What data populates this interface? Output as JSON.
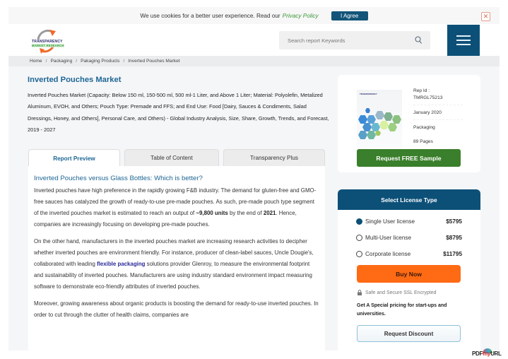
{
  "cookie_bar": {
    "message": "We use cookies for a better user experience. Read our",
    "privacy_link": "Privacy Policy",
    "agree_label": "I Agree",
    "close_icon": "close-icon"
  },
  "header": {
    "logo_line1": "TRANSPARENCY",
    "logo_line2": "MARKET RESEARCH",
    "search_placeholder": "Search report Keywords",
    "search_icon": "search-icon",
    "menu_icon": "hamburger-menu-icon"
  },
  "breadcrumb": [
    "Home",
    "Packaging",
    "Pakaging Products",
    "Inverted Pouches Market"
  ],
  "report": {
    "title": "Inverted Pouches Market",
    "subtitle": "Inverted Pouches Market (Capacity: Below 150 ml, 150-500 ml, 500 ml-1 Liter, and Above 1 Liter; Material: Polyolefin, Metalized Aluminum, EVOH, and Others; Pouch Type: Premade and FFS; and End Use: Food [Dairy, Sauces & Condiments, Salad Dressings, Honey, and Others], Personal Care, and Others) - Global Industry Analysis, Size, Share, Growth, Trends, and Forecast, 2019 - 2027"
  },
  "tabs": [
    {
      "label": "Report Preview",
      "active": true
    },
    {
      "label": "Table of Content",
      "active": false
    },
    {
      "label": "Transparency Plus",
      "active": false
    }
  ],
  "article": {
    "heading": "Inverted Pouches versus Glass Bottles: Which is better?",
    "p1_a": "Inverted pouches have high preference in the rapidly growing F&B industry. The demand for gluten-free and GMO-free sauces has catalyzed the growth of ready-to-use pre-made pouches. As such, pre-made pouch type segment of the inverted pouches market is estimated to reach an output of ",
    "p1_bold1": "~9,800 units",
    "p1_b": " by the end of ",
    "p1_bold2": "2021",
    "p1_c": ". Hence, companies are increasingly focusing on developing pre-made pouches.",
    "p2_a": "On the other hand, manufacturers in the inverted pouches market are increasing research activities to decipher whether inverted pouches are environment friendly. For instance, producer of clean-label sauces, Uncle Dougie's, collaborated with leading ",
    "p2_link": "flexible packaging",
    "p2_b": " solutions provider Glenroy, to measure the environmental footprint and sustainability of inverted pouches. Manufacturers are using industry standard environment impact measuring software to demonstrate eco-friendly attributes of inverted pouches.",
    "p3": "Moreover, growing awareness about organic products is boosting the demand for ready-to-use inverted pouches. In order to cut through the clutter of health claims, companies are"
  },
  "info": {
    "rep_id_label": "Rep Id :",
    "rep_id": "TMRGL75213",
    "date": "January 2020",
    "category": "Packaging",
    "pages": "89 Pages",
    "sample_label": "Request FREE Sample"
  },
  "license": {
    "heading": "Select License Type",
    "options": [
      {
        "label": "Single User license",
        "price": "$5795",
        "selected": true
      },
      {
        "label": "Multi-User license",
        "price": "$8795",
        "selected": false
      },
      {
        "label": "Corporate license",
        "price": "$11795",
        "selected": false
      }
    ],
    "buy_label": "Buy Now",
    "ssl_text": "Safe and Secure SSL Encrypted",
    "special_text": "Get A Special pricing for start-ups and universities.",
    "discount_label": "Request Discount"
  },
  "watermark": {
    "pre": "PDF",
    "mid": "my",
    "post": "URL"
  },
  "colors": {
    "brand_blue": "#0c5078",
    "title_blue": "#1e6695",
    "green": "#3a7f2b",
    "orange": "#ff6a14"
  }
}
